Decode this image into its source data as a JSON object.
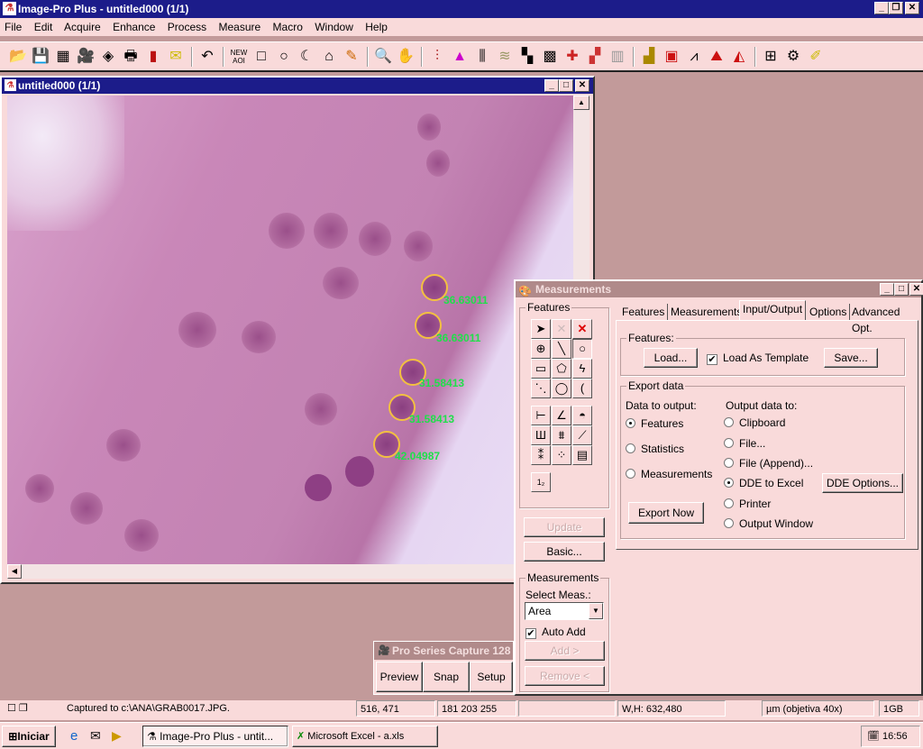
{
  "app": {
    "title": "Image-Pro Plus - untitled000 (1/1)",
    "window_buttons": [
      "_",
      "❐",
      "✕"
    ]
  },
  "menu": [
    "File",
    "Edit",
    "Acquire",
    "Enhance",
    "Process",
    "Measure",
    "Macro",
    "Window",
    "Help"
  ],
  "toolbar": {
    "icons": [
      "open-icon",
      "save-icon",
      "grid-icon",
      "camera-icon",
      "capture-icon",
      "print-icon",
      "book-icon",
      "mail-icon",
      "undo-icon",
      "new-aoi-icon",
      "rectangle-icon",
      "ellipse-icon",
      "irregular-icon",
      "magic-wand-icon",
      "pencil-icon",
      "zoom-icon",
      "pan-icon",
      "levels-icon",
      "histogram-icon",
      "equalize-icon",
      "layers-icon",
      "tile-icon",
      "filter-icon",
      "color-icon",
      "colormap-icon",
      "bar-icon",
      "measure-icon",
      "calibrate-icon",
      "line-profile-icon",
      "histo-chart-icon",
      "macro-icon",
      "tools-icon",
      "settings-icon"
    ],
    "new_aoi_label": "NEW AOI"
  },
  "image_window": {
    "title": "untitled000 (1/1)",
    "measurements": [
      "36.63011",
      "36.63011",
      "31.58413",
      "31.58413",
      "42.04987"
    ]
  },
  "measurements": {
    "title": "Measurements",
    "features_group": "Features",
    "tools": [
      "pointer",
      "delete-disabled",
      "delete-all",
      "crosshair",
      "line",
      "circle",
      "rectangle",
      "polygon",
      "freehand",
      "trace",
      "circle-outline",
      "arc",
      "distance",
      "angle",
      "protractor",
      "bars",
      "caliper",
      "ruler",
      "scatter",
      "dots",
      "table"
    ],
    "tabs": [
      "Features",
      "Measurements",
      "Input/Output",
      "Options",
      "Advanced Opt."
    ],
    "active_tab": "Input/Output",
    "io": {
      "features_label": "Features:",
      "load": "Load...",
      "load_as_template": "Load As Template",
      "load_as_template_checked": true,
      "save": "Save...",
      "export_label": "Export data",
      "data_to_output": "Data to output:",
      "data_options": [
        "Features",
        "Statistics",
        "Measurements"
      ],
      "data_selected": "Features",
      "output_to": "Output data to:",
      "output_options": [
        "Clipboard",
        "File...",
        "File (Append)...",
        "DDE to Excel",
        "Printer",
        "Output Window"
      ],
      "output_selected": "DDE to Excel",
      "dde_options": "DDE Options...",
      "export_now": "Export Now"
    },
    "update": "Update",
    "basic": "Basic...",
    "meas_group": "Measurements",
    "select_meas": "Select Meas.:",
    "select_value": "Area",
    "auto_add": "Auto Add",
    "auto_add_checked": true,
    "add": "Add >",
    "remove": "Remove <"
  },
  "capture": {
    "title": "Pro Series Capture 128",
    "buttons": [
      "Preview",
      "Snap",
      "Setup"
    ]
  },
  "status": {
    "message": "Captured to c:\\ANA\\GRAB0017.JPG.",
    "coords": "516, 471",
    "rgb": "181 203 255",
    "size": "W,H: 632,480",
    "calibration": "µm (objetiva 40x)",
    "memory": "1GB"
  },
  "taskbar": {
    "start": "Iniciar",
    "tasks": [
      "Image-Pro Plus - untit...",
      "Microsoft Excel - a.xls"
    ],
    "clock": "16:56"
  }
}
